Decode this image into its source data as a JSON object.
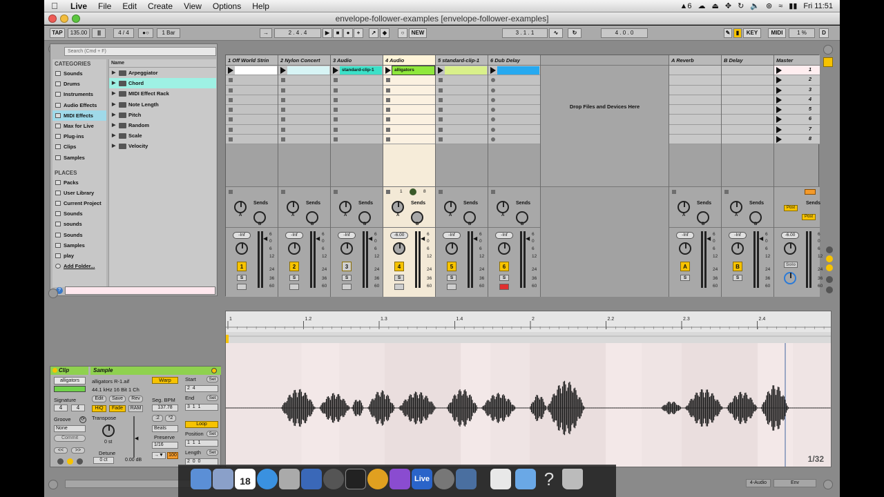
{
  "menubar": {
    "app_name": "Live",
    "items": [
      "File",
      "Edit",
      "Create",
      "View",
      "Options",
      "Help"
    ],
    "tray": {
      "adobe_count": "6",
      "clock": "Fri 11:51"
    }
  },
  "window": {
    "title": "envelope-follower-examples  [envelope-follower-examples]"
  },
  "transport": {
    "tap": "TAP",
    "tempo": "135.00",
    "signature": "4 / 4",
    "quantize": "1 Bar",
    "position": "2 .   4 .   4",
    "new": "NEW",
    "loop_start": "3 .   1 .   1",
    "loop_length": "4 .   0 .   0",
    "key": "KEY",
    "midi": "MIDI",
    "cpu": "1 %",
    "d": "D"
  },
  "browser": {
    "search_placeholder": "Search (Cmd + F)",
    "categories_header": "CATEGORIES",
    "categories": [
      "Sounds",
      "Drums",
      "Instruments",
      "Audio Effects",
      "MIDI Effects",
      "Max for Live",
      "Plug-ins",
      "Clips",
      "Samples"
    ],
    "selected_category": "MIDI Effects",
    "places_header": "PLACES",
    "places": [
      "Packs",
      "User Library",
      "Current Project",
      "Sounds",
      "sounds",
      "Sounds",
      "Samples",
      "play",
      "Add Folder..."
    ],
    "name_header": "Name",
    "files": [
      "Arpeggiator",
      "Chord",
      "MIDI Effect Rack",
      "Note Length",
      "Pitch",
      "Random",
      "Scale",
      "Velocity"
    ],
    "selected_file": "Chord"
  },
  "session": {
    "tracks": [
      {
        "name": "1 Off World Strin",
        "num": "1",
        "vol": "-Inf"
      },
      {
        "name": "2 Nylon Concert",
        "num": "2",
        "vol": "-Inf"
      },
      {
        "name": "3 Audio",
        "num": "3",
        "vol": "-Inf",
        "clip": "standard-clip-1"
      },
      {
        "name": "4 Audio",
        "num": "4",
        "vol": "-6.00",
        "clip": "alligators"
      },
      {
        "name": "5 standard-clip-1",
        "num": "5",
        "vol": "-Inf"
      },
      {
        "name": "6 Dub Delay",
        "num": "6",
        "vol": "-Inf"
      }
    ],
    "drop_text": "Drop Files and Devices Here",
    "returns": [
      {
        "name": "A Reverb",
        "num": "A",
        "vol": "-Inf"
      },
      {
        "name": "B Delay",
        "num": "B",
        "vol": "-Inf"
      }
    ],
    "master": {
      "name": "Master",
      "vol": "-6.00",
      "scenes": [
        "1",
        "2",
        "3",
        "4",
        "5",
        "6",
        "7",
        "8"
      ],
      "post": "Post",
      "solo": "Solo"
    },
    "sends_label": "Sends",
    "db_scale": [
      "6",
      "0",
      "6",
      "12",
      "24",
      "36",
      "60"
    ],
    "track4_status": {
      "left": "1",
      "right": "8"
    },
    "solo_label": "S",
    "knob_a": "A",
    "knob_b": "B"
  },
  "clip": {
    "header": "Clip",
    "name": "alligators",
    "signature_label": "Signature",
    "sig_num": "4",
    "sig_den": "4",
    "groove_label": "Groove",
    "groove": "None",
    "commit": "Commit"
  },
  "sample": {
    "header": "Sample",
    "file": "alligators R-1.aif",
    "format": "44.1 kHz 16 Bit 1 Ch",
    "warp": "Warp",
    "edit": "Edit",
    "save": "Save",
    "rev": "Rev",
    "hiq": "HiQ",
    "fade": "Fade",
    "ram": "RAM",
    "seg_bpm_label": "Seg. BPM",
    "seg_bpm": "137.78",
    "transpose_label": "Transpose",
    "transpose": "0 st",
    "detune_label": "Detune",
    "detune": "0 ct",
    "gain": "0.00 dB",
    "preserve_label": "Preserve",
    "beats": "Beats",
    "preserve_val": "1/16",
    "start_label": "Start",
    "end_label": "End",
    "loop": "Loop",
    "position_label": "Position",
    "length_label": "Length",
    "set": "Set",
    "ruler": [
      "1",
      "1.2",
      "1.3",
      "1.4",
      "2",
      "2.2",
      "2.3",
      "2.4"
    ],
    "zoom": "1/32"
  },
  "dock": {
    "calendar_day": "18",
    "live": "Live"
  },
  "status": {
    "track": "4-Audio",
    "env": "Env"
  }
}
